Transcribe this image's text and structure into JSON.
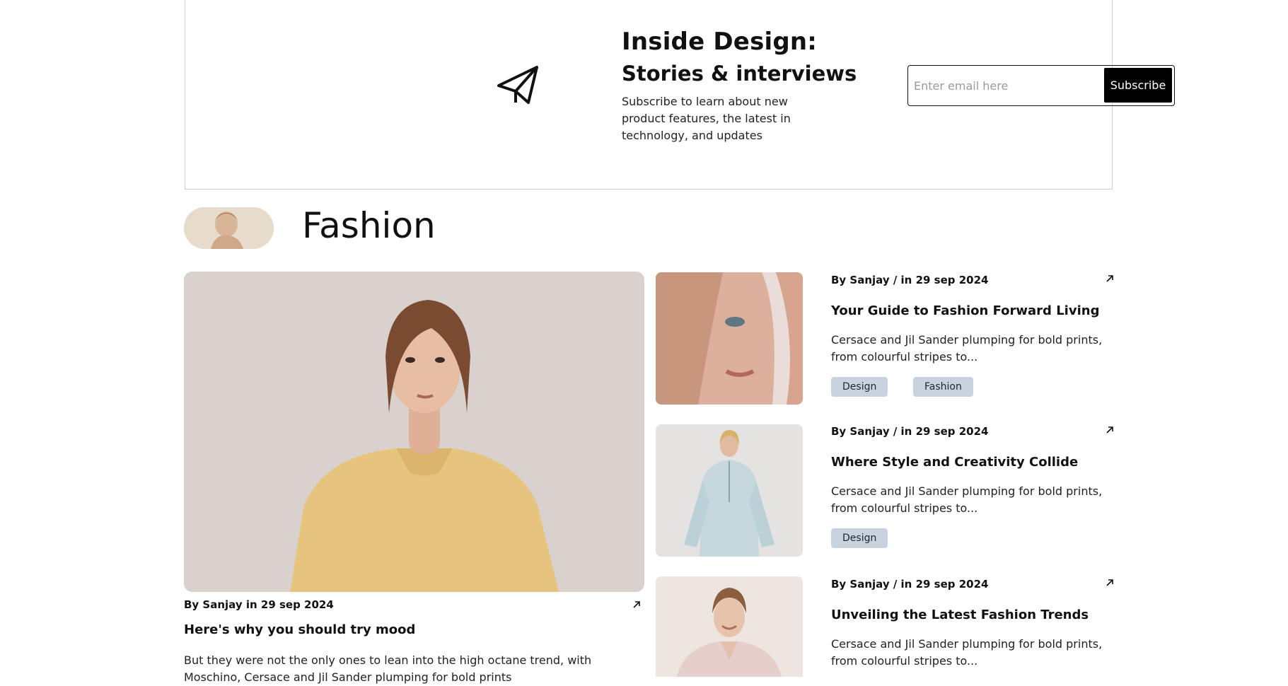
{
  "newsletter": {
    "title": "Inside Design:",
    "subtitle": "Stories & interviews",
    "description": "Subscribe to learn about new product features, the latest in technology, and updates",
    "email_placeholder": "Enter email here",
    "subscribe_label": "Subscribe"
  },
  "section": {
    "title": "Fashion"
  },
  "hero": {
    "meta": "By Sanjay in 29 sep 2024",
    "title": "Here's why you should try mood",
    "excerpt": "But they were not the only ones to lean into the high octane trend, with Moschino, Cersace and Jil Sander plumping for bold prints"
  },
  "articles": [
    {
      "meta": "By Sanjay / in 29 sep 2024",
      "title": "Your Guide to Fashion Forward Living",
      "excerpt": "Cersace and Jil Sander plumping for bold prints, from colourful stripes to...",
      "tags": [
        "Design",
        "Fashion"
      ]
    },
    {
      "meta": "By Sanjay / in 29 sep 2024",
      "title": "Where Style and Creativity Collide",
      "excerpt": "Cersace and Jil Sander plumping for bold prints, from colourful stripes to...",
      "tags": [
        "Design"
      ]
    },
    {
      "meta": "By Sanjay / in 29 sep 2024",
      "title": "Unveiling the Latest Fashion Trends",
      "excerpt": "Cersace and Jil Sander plumping for bold prints, from colourful stripes to...",
      "tags": []
    }
  ],
  "colors": {
    "tag_bg": "#c9d2df",
    "button_bg": "#000000"
  },
  "icons": {
    "newsletter": "paper-plane-icon",
    "article_link": "arrow-up-right-icon"
  }
}
